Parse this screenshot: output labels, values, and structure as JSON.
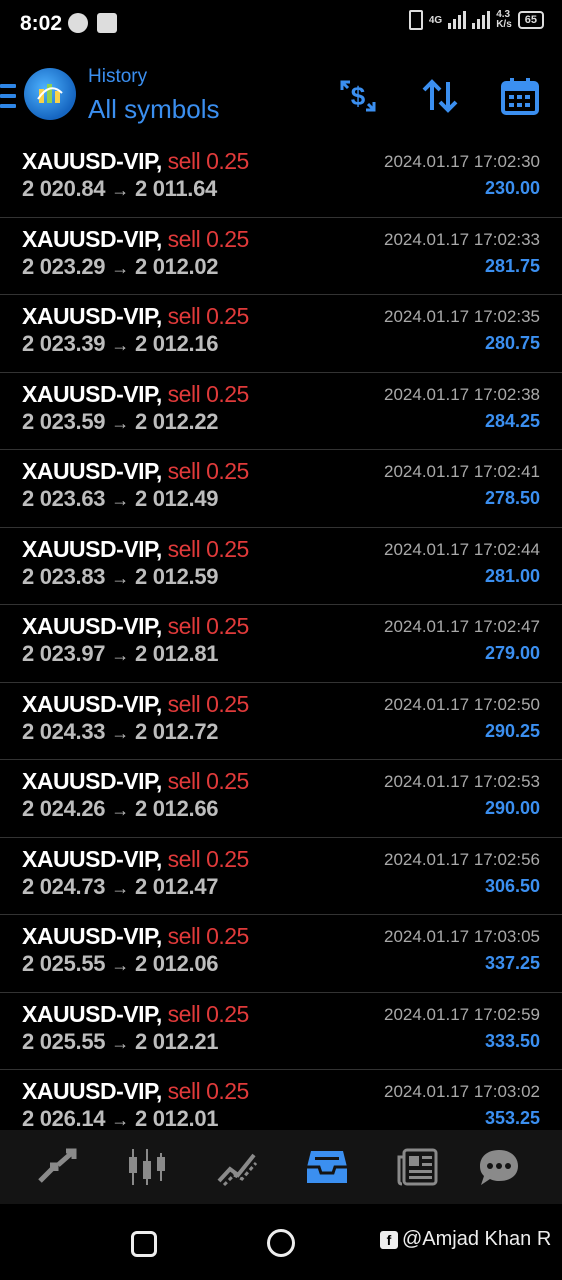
{
  "status": {
    "time": "8:02",
    "network": "4G",
    "speed_top": "4.3",
    "speed_bottom": "K/s",
    "battery": "65"
  },
  "header": {
    "title": "History",
    "subtitle": "All symbols"
  },
  "trades": [
    {
      "symbol": "XAUUSD-VIP,",
      "type": "sell 0.25",
      "open": "2 020.84",
      "close": "2 011.64",
      "time": "2024.01.17 17:02:30",
      "profit": "230.00"
    },
    {
      "symbol": "XAUUSD-VIP,",
      "type": "sell 0.25",
      "open": "2 023.29",
      "close": "2 012.02",
      "time": "2024.01.17 17:02:33",
      "profit": "281.75"
    },
    {
      "symbol": "XAUUSD-VIP,",
      "type": "sell 0.25",
      "open": "2 023.39",
      "close": "2 012.16",
      "time": "2024.01.17 17:02:35",
      "profit": "280.75"
    },
    {
      "symbol": "XAUUSD-VIP,",
      "type": "sell 0.25",
      "open": "2 023.59",
      "close": "2 012.22",
      "time": "2024.01.17 17:02:38",
      "profit": "284.25"
    },
    {
      "symbol": "XAUUSD-VIP,",
      "type": "sell 0.25",
      "open": "2 023.63",
      "close": "2 012.49",
      "time": "2024.01.17 17:02:41",
      "profit": "278.50"
    },
    {
      "symbol": "XAUUSD-VIP,",
      "type": "sell 0.25",
      "open": "2 023.83",
      "close": "2 012.59",
      "time": "2024.01.17 17:02:44",
      "profit": "281.00"
    },
    {
      "symbol": "XAUUSD-VIP,",
      "type": "sell 0.25",
      "open": "2 023.97",
      "close": "2 012.81",
      "time": "2024.01.17 17:02:47",
      "profit": "279.00"
    },
    {
      "symbol": "XAUUSD-VIP,",
      "type": "sell 0.25",
      "open": "2 024.33",
      "close": "2 012.72",
      "time": "2024.01.17 17:02:50",
      "profit": "290.25"
    },
    {
      "symbol": "XAUUSD-VIP,",
      "type": "sell 0.25",
      "open": "2 024.26",
      "close": "2 012.66",
      "time": "2024.01.17 17:02:53",
      "profit": "290.00"
    },
    {
      "symbol": "XAUUSD-VIP,",
      "type": "sell 0.25",
      "open": "2 024.73",
      "close": "2 012.47",
      "time": "2024.01.17 17:02:56",
      "profit": "306.50"
    },
    {
      "symbol": "XAUUSD-VIP,",
      "type": "sell 0.25",
      "open": "2 025.55",
      "close": "2 012.06",
      "time": "2024.01.17 17:03:05",
      "profit": "337.25"
    },
    {
      "symbol": "XAUUSD-VIP,",
      "type": "sell 0.25",
      "open": "2 025.55",
      "close": "2 012.21",
      "time": "2024.01.17 17:02:59",
      "profit": "333.50"
    },
    {
      "symbol": "XAUUSD-VIP,",
      "type": "sell 0.25",
      "open": "2 026.14",
      "close": "2 012.01",
      "time": "2024.01.17 17:03:02",
      "profit": "353.25"
    }
  ],
  "arrow_glyph": "→",
  "icons": {
    "header": [
      "menu-icon",
      "dollar-exchange-icon",
      "sort-icon",
      "calendar-icon"
    ],
    "bottom_nav": [
      "quotes-icon",
      "chart-icon",
      "trade-icon",
      "history-icon",
      "news-icon",
      "messages-icon"
    ]
  },
  "watermark": "@Amjad Khan R",
  "colors": {
    "accent": "#3b8ff0",
    "sell": "#e03a3a",
    "background": "#000000",
    "nav_bg": "#141414"
  }
}
